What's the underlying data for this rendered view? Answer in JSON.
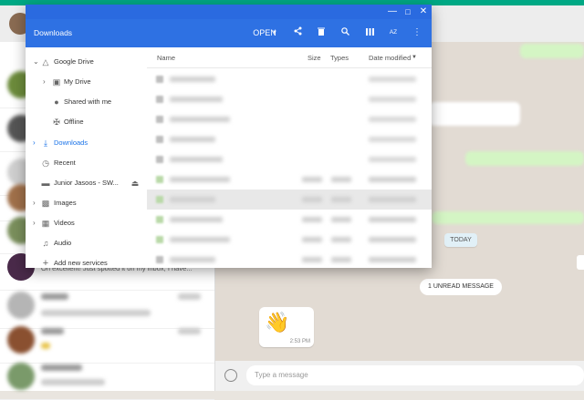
{
  "window": {
    "title": "Downloads"
  },
  "toolbar": {
    "open_label": "OPEN",
    "sort_label": "AZ",
    "icons": [
      "share-icon",
      "delete-icon",
      "search-icon",
      "grid-view-icon",
      "sort-icon",
      "more-icon"
    ]
  },
  "sidebar": {
    "items": [
      {
        "label": "Google Drive",
        "icon": "drive-icon"
      },
      {
        "label": "My Drive",
        "icon": "folder-icon"
      },
      {
        "label": "Shared with me",
        "icon": "people-icon"
      },
      {
        "label": "Offline",
        "icon": "pin-icon"
      },
      {
        "label": "Downloads",
        "icon": "download-icon"
      },
      {
        "label": "Recent",
        "icon": "clock-icon"
      },
      {
        "label": "Junior Jasoos - SW...",
        "icon": "usb-icon"
      },
      {
        "label": "Images",
        "icon": "image-icon"
      },
      {
        "label": "Videos",
        "icon": "video-icon"
      },
      {
        "label": "Audio",
        "icon": "audio-icon"
      },
      {
        "label": "Add new services",
        "icon": "add-icon"
      }
    ]
  },
  "file_list": {
    "columns": [
      "Name",
      "Size",
      "Types",
      "Date modified"
    ],
    "row_count": 10
  },
  "chat": {
    "today_label": "TODAY",
    "unread_label": "1 UNREAD MESSAGE",
    "emoji": "👋",
    "time": "2:53 PM",
    "message_placeholder": "Type a message",
    "preview_text": "Oh excellent! Just spotted it on my inbox, I have..."
  },
  "colors": {
    "accent": "#2e71e3",
    "whatsapp_green": "#00a884",
    "active_blue": "#1a73e8"
  }
}
